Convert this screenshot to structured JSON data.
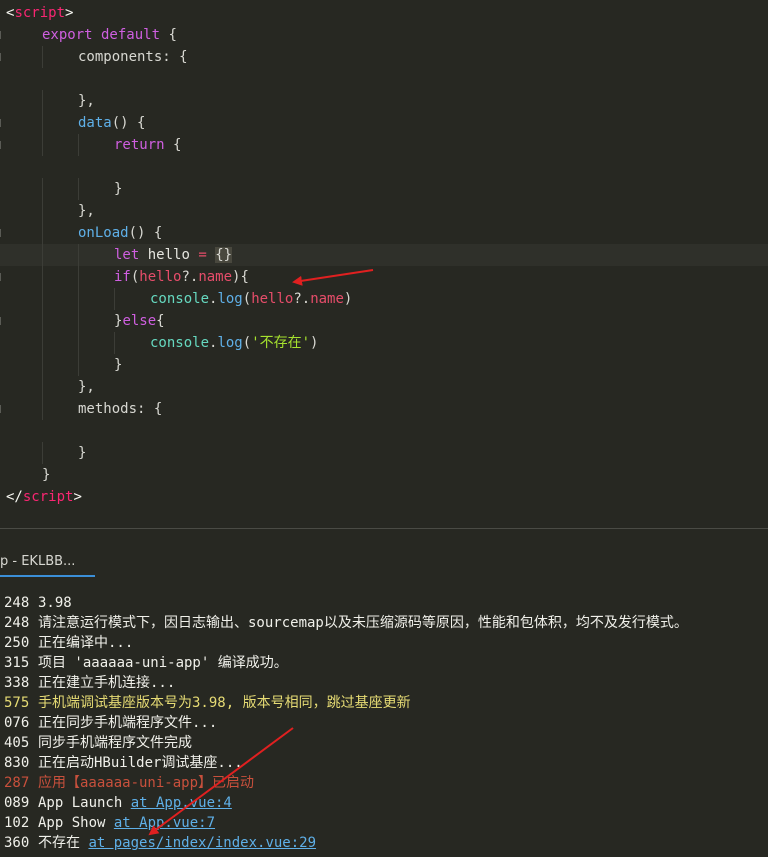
{
  "editor": {
    "lines": [
      {
        "indent": 0,
        "tokens": [
          {
            "c": "tk-tag",
            "t": "<"
          },
          {
            "c": "tk-tagname",
            "t": "script"
          },
          {
            "c": "tk-tag",
            "t": ">"
          }
        ]
      },
      {
        "indent": 1,
        "tokens": [
          {
            "c": "tk-kw",
            "t": "export default"
          },
          {
            "c": "tk-punc",
            "t": " {"
          }
        ]
      },
      {
        "indent": 2,
        "tokens": [
          {
            "c": "tk-prop",
            "t": "components"
          },
          {
            "c": "tk-punc",
            "t": ": {"
          }
        ]
      },
      {
        "indent": 0,
        "tokens": []
      },
      {
        "indent": 2,
        "tokens": [
          {
            "c": "tk-punc",
            "t": "},"
          }
        ]
      },
      {
        "indent": 2,
        "tokens": [
          {
            "c": "tk-fn",
            "t": "data"
          },
          {
            "c": "tk-punc",
            "t": "() {"
          }
        ]
      },
      {
        "indent": 3,
        "tokens": [
          {
            "c": "tk-kw",
            "t": "return"
          },
          {
            "c": "tk-punc",
            "t": " {"
          }
        ]
      },
      {
        "indent": 0,
        "tokens": []
      },
      {
        "indent": 3,
        "tokens": [
          {
            "c": "tk-punc",
            "t": "}"
          }
        ]
      },
      {
        "indent": 2,
        "tokens": [
          {
            "c": "tk-punc",
            "t": "},"
          }
        ]
      },
      {
        "indent": 2,
        "tokens": [
          {
            "c": "tk-fn",
            "t": "onLoad"
          },
          {
            "c": "tk-punc",
            "t": "() {"
          }
        ]
      },
      {
        "indent": 3,
        "tokens": [
          {
            "c": "tk-kw",
            "t": "let"
          },
          {
            "c": "tk-var",
            "t": " hello "
          },
          {
            "c": "tk-op",
            "t": "="
          },
          {
            "c": "tk-var",
            "t": " "
          },
          {
            "c": "tk-brace-hl",
            "t": "{}"
          }
        ]
      },
      {
        "indent": 3,
        "tokens": [
          {
            "c": "tk-kw",
            "t": "if"
          },
          {
            "c": "tk-punc",
            "t": "("
          },
          {
            "c": "tk-attr",
            "t": "hello"
          },
          {
            "c": "tk-punc",
            "t": "?."
          },
          {
            "c": "tk-attr",
            "t": "name"
          },
          {
            "c": "tk-punc",
            "t": "){"
          }
        ]
      },
      {
        "indent": 4,
        "tokens": [
          {
            "c": "tk-obj",
            "t": "console"
          },
          {
            "c": "tk-punc",
            "t": "."
          },
          {
            "c": "tk-fn",
            "t": "log"
          },
          {
            "c": "tk-punc",
            "t": "("
          },
          {
            "c": "tk-attr",
            "t": "hello"
          },
          {
            "c": "tk-punc",
            "t": "?."
          },
          {
            "c": "tk-attr",
            "t": "name"
          },
          {
            "c": "tk-punc",
            "t": ")"
          }
        ]
      },
      {
        "indent": 3,
        "tokens": [
          {
            "c": "tk-punc",
            "t": "}"
          },
          {
            "c": "tk-kw",
            "t": "else"
          },
          {
            "c": "tk-punc",
            "t": "{"
          }
        ]
      },
      {
        "indent": 4,
        "tokens": [
          {
            "c": "tk-obj",
            "t": "console"
          },
          {
            "c": "tk-punc",
            "t": "."
          },
          {
            "c": "tk-fn",
            "t": "log"
          },
          {
            "c": "tk-punc",
            "t": "("
          },
          {
            "c": "tk-str",
            "t": "'不存在'"
          },
          {
            "c": "tk-punc",
            "t": ")"
          }
        ]
      },
      {
        "indent": 3,
        "tokens": [
          {
            "c": "tk-punc",
            "t": "}"
          }
        ]
      },
      {
        "indent": 2,
        "tokens": [
          {
            "c": "tk-punc",
            "t": "},"
          }
        ]
      },
      {
        "indent": 2,
        "tokens": [
          {
            "c": "tk-prop",
            "t": "methods"
          },
          {
            "c": "tk-punc",
            "t": ": {"
          }
        ]
      },
      {
        "indent": 0,
        "tokens": []
      },
      {
        "indent": 2,
        "tokens": [
          {
            "c": "tk-punc",
            "t": "}"
          }
        ]
      },
      {
        "indent": 1,
        "tokens": [
          {
            "c": "tk-punc",
            "t": "}"
          }
        ]
      },
      {
        "indent": 0,
        "tokens": [
          {
            "c": "tk-tag",
            "t": "</"
          },
          {
            "c": "tk-tagname",
            "t": "script"
          },
          {
            "c": "tk-tag",
            "t": ">"
          }
        ]
      }
    ]
  },
  "console_tab": {
    "label": "p - EKLBB..."
  },
  "console": {
    "lines": [
      {
        "num": "248",
        "text": "3.98",
        "style": ""
      },
      {
        "num": "248",
        "text": "请注意运行模式下，因日志输出、sourcemap以及未压缩源码等原因，性能和包体积，均不及发行模式。",
        "style": ""
      },
      {
        "num": "250",
        "text": "正在编译中...",
        "style": ""
      },
      {
        "num": "315",
        "text": "项目 'aaaaaa-uni-app' 编译成功。",
        "style": ""
      },
      {
        "num": "338",
        "text": "正在建立手机连接...",
        "style": ""
      },
      {
        "num": "575",
        "text": "手机端调试基座版本号为3.98, 版本号相同，跳过基座更新",
        "style": "yellow"
      },
      {
        "num": "076",
        "text": "正在同步手机端程序文件...",
        "style": ""
      },
      {
        "num": "405",
        "text": "同步手机端程序文件完成",
        "style": ""
      },
      {
        "num": "830",
        "text": "正在启动HBuilder调试基座...",
        "style": ""
      },
      {
        "num": "287",
        "text": "应用【aaaaaa-uni-app】已启动",
        "style": "dim"
      },
      {
        "num": "089",
        "text": "App Launch ",
        "link": "at App.vue:4",
        "style": ""
      },
      {
        "num": "102",
        "text": "App Show ",
        "link": "at App.vue:7",
        "style": ""
      },
      {
        "num": "360",
        "text": "不存在 ",
        "link": "at pages/index/index.vue:29",
        "style": ""
      }
    ]
  }
}
